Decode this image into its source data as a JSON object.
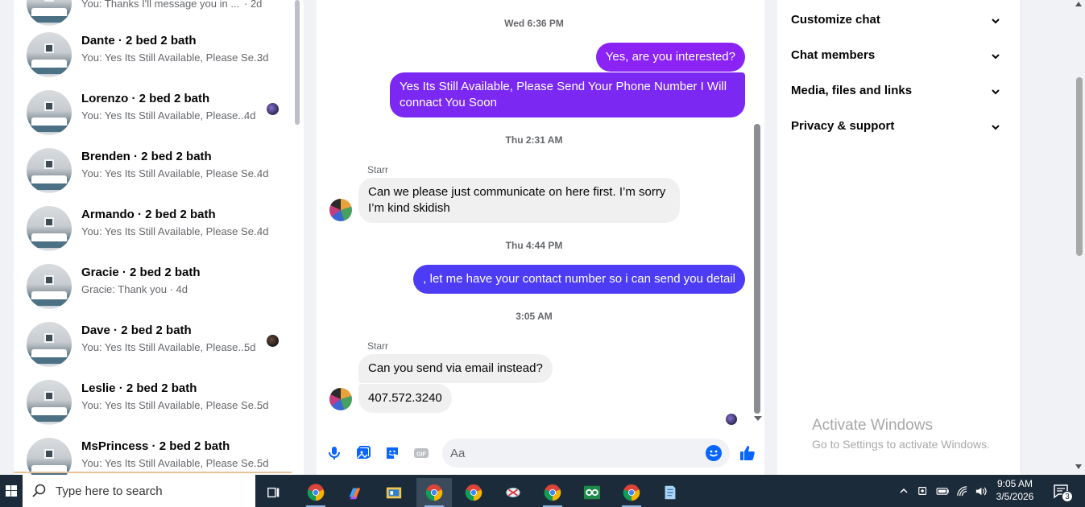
{
  "chat_list": {
    "items": [
      {
        "name": "",
        "preview": "You: Thanks I'll message you in ... ",
        "time": "· 2d"
      },
      {
        "name": "Dante · 2 bed 2 bath",
        "preview": "You: Yes Its Still Available, Please Se...",
        "time": "3d"
      },
      {
        "name": "Lorenzo · 2 bed 2 bath",
        "preview": "You: Yes Its Still Available, Please...",
        "time": "4d"
      },
      {
        "name": "Brenden · 2 bed 2 bath",
        "preview": "You: Yes Its Still Available, Please Se...",
        "time": "4d"
      },
      {
        "name": "Armando · 2 bed 2 bath",
        "preview": "You: Yes Its Still Available, Please Se...",
        "time": "4d"
      },
      {
        "name": "Gracie · 2 bed 2 bath",
        "preview": "Gracie: Thank you · 4d",
        "time": ""
      },
      {
        "name": "Dave · 2 bed 2 bath",
        "preview": "You: Yes Its Still Available, Please...",
        "time": "5d"
      },
      {
        "name": "Leslie · 2 bed 2 bath",
        "preview": "You: Yes Its Still Available, Please Se...",
        "time": "5d"
      },
      {
        "name": "MsPrincess · 2 bed 2 bath",
        "preview": "You: Yes Its Still Available, Please Se...",
        "time": "5d"
      }
    ]
  },
  "conversation": {
    "timestamps": [
      "Wed 6:36 PM",
      "Thu 2:31 AM",
      "Thu 4:44 PM",
      "3:05 AM"
    ],
    "messages": [
      {
        "from": "me",
        "text": "Yes, are you interested?"
      },
      {
        "from": "me",
        "text": "Yes Its Still Available, Please Send Your Phone Number I Will connact You Soon"
      },
      {
        "from": "Starr",
        "text": "Can we please just communicate on here first. I’m sorry I’m kind skidish"
      },
      {
        "from": "me",
        "text": ", let me have your contact number so i can send you detail"
      },
      {
        "from": "Starr",
        "text": "Can you send via email instead?"
      },
      {
        "from": "Starr",
        "text": "407.572.3240"
      }
    ],
    "sender_name": "Starr",
    "composer_placeholder": "Aa"
  },
  "info_panel": {
    "sections": [
      "Customize chat",
      "Chat members",
      "Media, files and links",
      "Privacy & support"
    ]
  },
  "watermark": {
    "title": "Activate Windows",
    "subtitle": "Go to Settings to activate Windows."
  },
  "taskbar": {
    "search_placeholder": "Type here to search",
    "time": "9:05 AM",
    "date": "3/5/2026",
    "notification_count": "3"
  },
  "colors": {
    "outgoing_purple": "#8a23f3",
    "outgoing_indigo": "#4d3cf5",
    "incoming": "#f0f0f0",
    "taskbar": "#1c2b3a"
  }
}
